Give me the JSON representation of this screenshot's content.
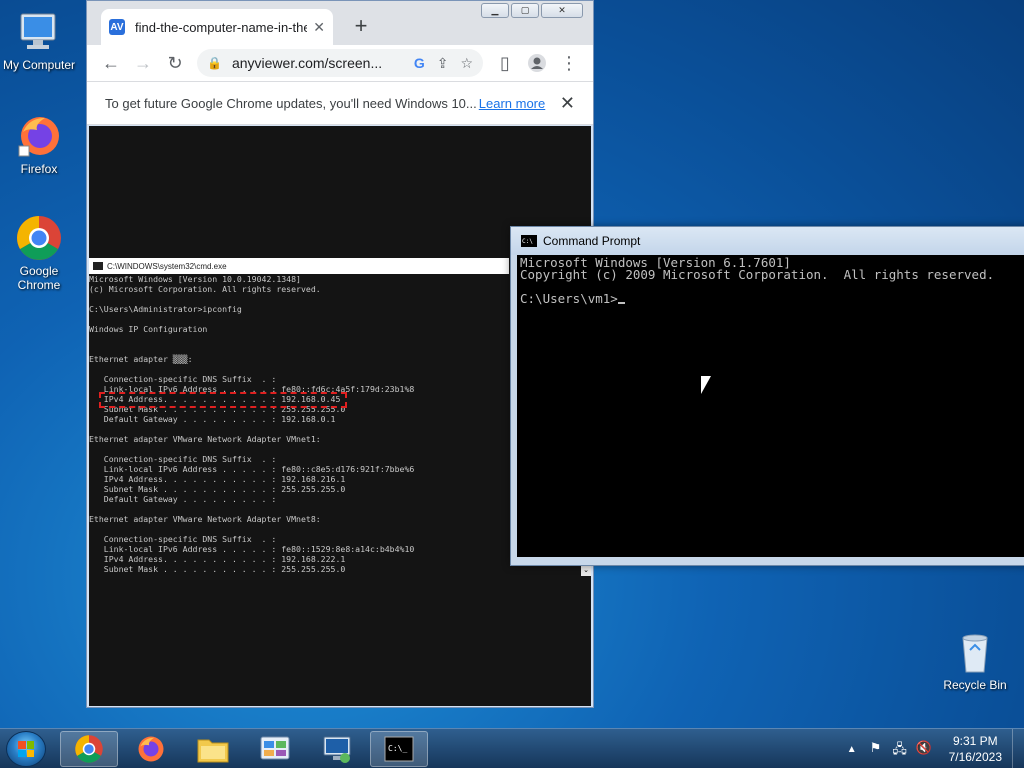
{
  "desktop": {
    "icons": [
      {
        "label": "My Computer"
      },
      {
        "label": "Firefox"
      },
      {
        "label": "Google\nChrome"
      },
      {
        "label": "Recycle Bin"
      }
    ]
  },
  "chrome": {
    "tab_title": "find-the-computer-name-in-the-",
    "tab_favicon": "AV",
    "url": "anyviewer.com/screen...",
    "infobar_message": "To get future Google Chrome updates, you'll need Windows 10...",
    "infobar_link": "Learn more",
    "embedded_title": "C:\\WINDOWS\\system32\\cmd.exe",
    "embedded_console": "Microsoft Windows [Version 10.0.19042.1348]\n(c) Microsoft Corporation. All rights reserved.\n\nC:\\Users\\Administrator>ipconfig\n\nWindows IP Configuration\n\n\nEthernet adapter ▒▒▒:\n\n   Connection-specific DNS Suffix  . :\n   Link-local IPv6 Address . . . . . : fe80::fd6c:4a5f:179d:23b1%8\n   IPv4 Address. . . . . . . . . . . : 192.168.0.45\n   Subnet Mask . . . . . . . . . . . : 255.255.255.0\n   Default Gateway . . . . . . . . . : 192.168.0.1\n\nEthernet adapter VMware Network Adapter VMnet1:\n\n   Connection-specific DNS Suffix  . :\n   Link-local IPv6 Address . . . . . : fe80::c8e5:d176:921f:7bbe%6\n   IPv4 Address. . . . . . . . . . . : 192.168.216.1\n   Subnet Mask . . . . . . . . . . . : 255.255.255.0\n   Default Gateway . . . . . . . . . :\n\nEthernet adapter VMware Network Adapter VMnet8:\n\n   Connection-specific DNS Suffix  . :\n   Link-local IPv6 Address . . . . . : fe80::1529:8e8:a14c:b4b4%10\n   IPv4 Address. . . . . . . . . . . : 192.168.222.1\n   Subnet Mask . . . . . . . . . . . : 255.255.255.0"
  },
  "cmd": {
    "title": "Command Prompt",
    "line1": "Microsoft Windows [Version 6.1.7601]",
    "line2": "Copyright (c) 2009 Microsoft Corporation.  All rights reserved.",
    "prompt": "C:\\Users\\vm1>"
  },
  "taskbar": {
    "time": "9:31 PM",
    "date": "7/16/2023"
  },
  "colors": {
    "desktop_blue": "#0f63b4",
    "chrome_link": "#1a73e8",
    "highlight_red": "#e02020"
  }
}
